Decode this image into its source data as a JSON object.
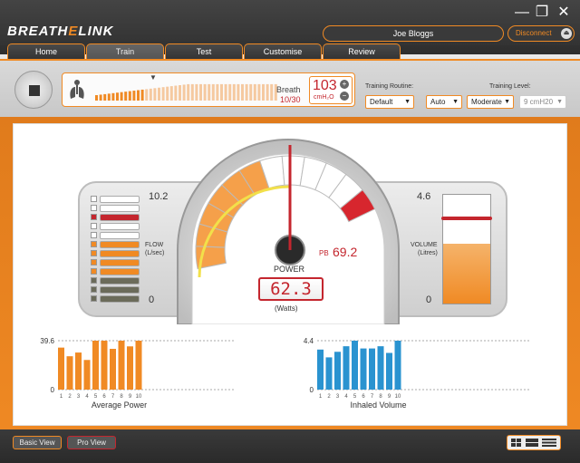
{
  "app": {
    "logo_left": "BREATH",
    "logo_mid": "E",
    "logo_right": "LINK",
    "minimize": "—",
    "restore": "❐",
    "close": "✕"
  },
  "header": {
    "user_name": "Joe Bloggs",
    "disconnect_label": "Disconnect"
  },
  "tabs": [
    {
      "label": "Home",
      "active": false
    },
    {
      "label": "Train",
      "active": true
    },
    {
      "label": "Test",
      "active": false
    },
    {
      "label": "Customise",
      "active": false
    },
    {
      "label": "Review",
      "active": false
    }
  ],
  "controls": {
    "breath_label": "Breath",
    "breath_count": "10/30",
    "pressure_value": "103",
    "pressure_unit": "cmH₂O",
    "training_routine_label": "Training Routine:",
    "training_routine_value": "Default",
    "training_level_label": "Training Level:",
    "mode_value": "Auto",
    "level_value": "Moderate",
    "level_pressure_value": "9 cmH20"
  },
  "dashboard": {
    "flow_max": "10.2",
    "flow_min": "0",
    "flow_label": "FLOW",
    "flow_unit": "(L/sec)",
    "volume_max": "4.6",
    "volume_min": "0",
    "volume_label": "VOLUME",
    "volume_unit": "(Litres)",
    "volume_fill_fraction": 0.55,
    "power_label": "POWER",
    "power_value": "62.3",
    "power_unit": "(Watts)",
    "pb_label": "PB",
    "pb_value": "69.2"
  },
  "chart_data": [
    {
      "type": "bar",
      "title": "Average Power",
      "categories": [
        "1",
        "2",
        "3",
        "4",
        "5",
        "6",
        "7",
        "8",
        "9",
        "10"
      ],
      "values": [
        34,
        27,
        30,
        24,
        39.6,
        39.6,
        33,
        39.6,
        35,
        39.6
      ],
      "ymax_label": "39.6",
      "ymin_label": "0",
      "ylim": [
        0,
        39.6
      ],
      "color": "#f08a24"
    },
    {
      "type": "bar",
      "title": "Inhaled Volume",
      "categories": [
        "1",
        "2",
        "3",
        "4",
        "5",
        "6",
        "7",
        "8",
        "9",
        "10"
      ],
      "values": [
        3.6,
        2.9,
        3.4,
        3.9,
        4.4,
        3.7,
        3.7,
        3.9,
        3.3,
        4.4
      ],
      "ymax_label": "4.4",
      "ymin_label": "0",
      "ylim": [
        0,
        4.4
      ],
      "color": "#2a93d0"
    }
  ],
  "footer": {
    "basic_view": "Basic View",
    "pro_view": "Pro View"
  }
}
